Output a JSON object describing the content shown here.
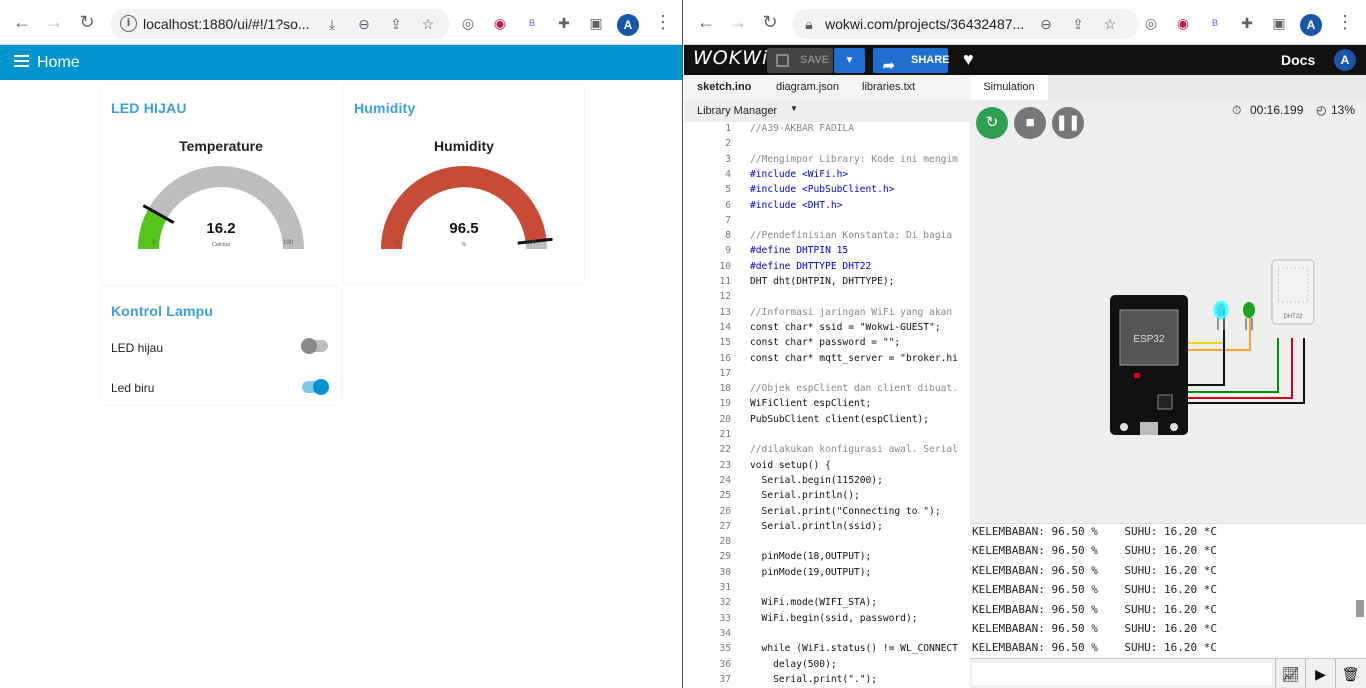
{
  "left_browser": {
    "url": "localhost:1880/ui/#!/1?so..."
  },
  "right_browser": {
    "url": "wokwi.com/projects/36432487..."
  },
  "avatar_letter": "A",
  "dashboard": {
    "title": "Home",
    "groups": [
      {
        "title": "LED HIJAU",
        "gauge_name": "Temperature",
        "value": "16.2",
        "unit": "Celcius",
        "min": "0",
        "max": "100",
        "level": 0.162,
        "color": "#55c41a"
      },
      {
        "title": "Humidity",
        "gauge_name": "Humidity",
        "value": "96.5",
        "unit": "%",
        "min": "0",
        "max": "100",
        "level": 0.965,
        "color": "#c84b35"
      }
    ],
    "control": {
      "title": "Kontrol Lampu",
      "switches": [
        {
          "label": "LED hijau",
          "on": false
        },
        {
          "label": "Led biru",
          "on": true
        }
      ]
    }
  },
  "wokwi": {
    "logo": "WOKWi",
    "save": "SAVE",
    "share": "SHARE",
    "docs": "Docs",
    "tabs": [
      "sketch.ino",
      "diagram.json",
      "libraries.txt"
    ],
    "library_manager": "Library Manager",
    "simulation_tab": "Simulation",
    "timer": "00:16.199",
    "speed": "13%",
    "esp_label": "ESP32",
    "dht_label": "DHT22",
    "code_lines": [
      "//A39-AKBAR FADILA",
      "",
      "//Mengimpor Library: Kode ini mengim",
      "#include <WiFi.h>",
      "#include <PubSubClient.h>",
      "#include <DHT.h>",
      "",
      "//Pendefinisian Konstanta: Di bagia",
      "#define DHTPIN 15",
      "#define DHTTYPE DHT22",
      "DHT dht(DHTPIN, DHTTYPE);",
      "",
      "//Informasi jaringan WiFi yang akan",
      "const char* ssid = \"Wokwi-GUEST\";",
      "const char* password = \"\";",
      "const char* mqtt_server = \"broker.hi",
      "",
      "//Objek espClient dan client dibuat.",
      "WiFiClient espClient;",
      "PubSubClient client(espClient);",
      "",
      "//dilakukan konfigurasi awal. Serial",
      "void setup() {",
      "  Serial.begin(115200);",
      "  Serial.println();",
      "  Serial.print(\"Connecting to \");",
      "  Serial.println(ssid);",
      "",
      "  pinMode(18,OUTPUT);",
      "  pinMode(19,OUTPUT);",
      "",
      "  WiFi.mode(WIFI_STA);",
      "  WiFi.begin(ssid, password);",
      "",
      "  while (WiFi.status() != WL_CONNECT",
      "    delay(500);",
      "    Serial.print(\".\");"
    ],
    "serial_lines": [
      "KELEMBABAN: 96.50 %    SUHU: 16.20 *C",
      "KELEMBABAN: 96.50 %    SUHU: 16.20 *C",
      "KELEMBABAN: 96.50 %    SUHU: 16.20 *C",
      "KELEMBABAN: 96.50 %    SUHU: 16.20 *C",
      "KELEMBABAN: 96.50 %    SUHU: 16.20 *C",
      "KELEMBABAN: 96.50 %    SUHU: 16.20 *C",
      "KELEMBABAN: 96.50 %    SUHU: 16.20 *C"
    ]
  }
}
